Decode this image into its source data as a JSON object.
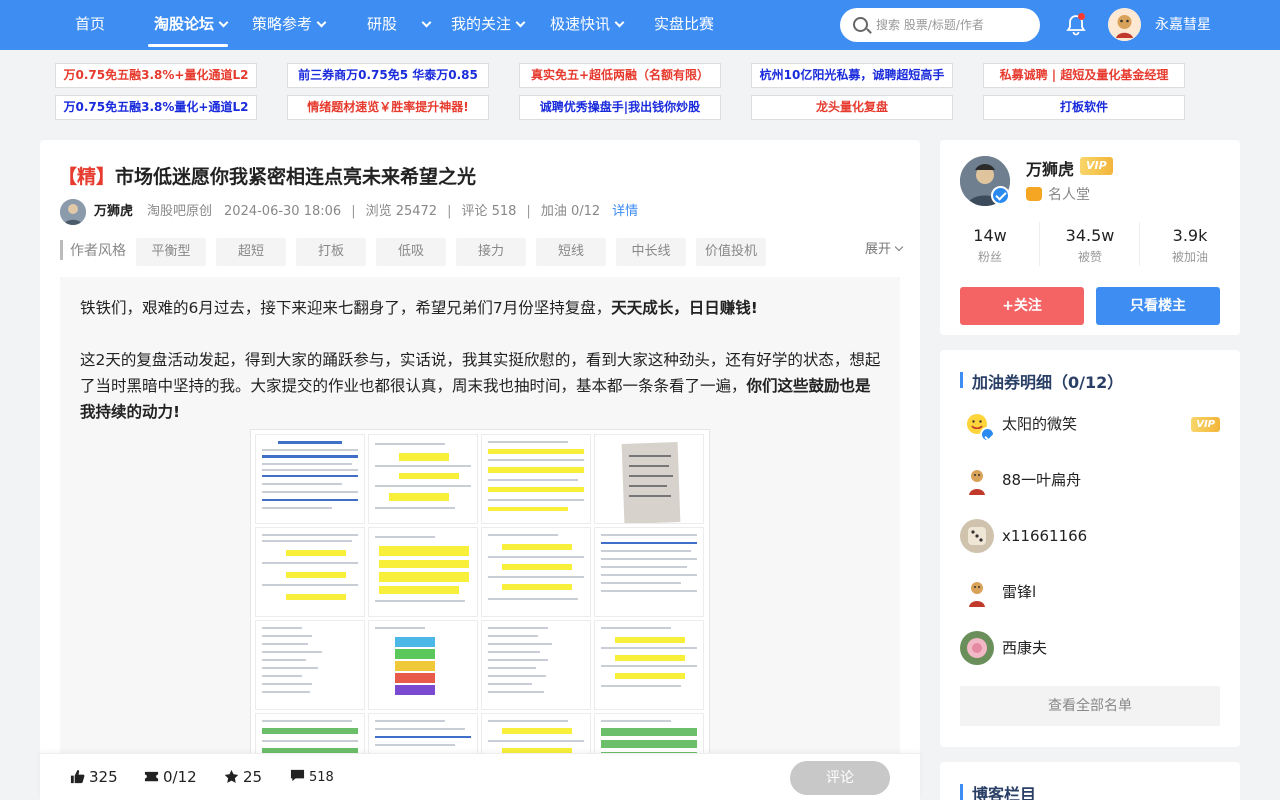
{
  "nav": {
    "items": [
      {
        "label": "首页",
        "dropdown": false,
        "active": false
      },
      {
        "label": "淘股论坛",
        "dropdown": true,
        "active": true
      },
      {
        "label": "策略参考",
        "dropdown": true,
        "active": false
      },
      {
        "label": "研股",
        "dropdown": true,
        "active": false
      },
      {
        "label": "我的关注",
        "dropdown": true,
        "active": false
      },
      {
        "label": "极速快讯",
        "dropdown": true,
        "active": false
      },
      {
        "label": "实盘比赛",
        "dropdown": false,
        "active": false
      }
    ],
    "search_placeholder": "搜索 股票/标题/作者",
    "username": "永嘉彗星",
    "accent": "#3d8df3"
  },
  "ads": [
    {
      "label": "万0.75免五融3.8%+量化通道L2",
      "color": "red"
    },
    {
      "label": "前三券商万0.75免5 华泰万0.85",
      "color": "blue"
    },
    {
      "label": "真实免五+超低两融（名额有限）",
      "color": "red"
    },
    {
      "label": "杭州10亿阳光私募，诚聘超短高手",
      "color": "blue"
    },
    {
      "label": "私募诚聘 | 超短及量化基金经理",
      "color": "red"
    },
    {
      "label": "万0.75免五融3.8%量化+通道L2",
      "color": "blue"
    },
    {
      "label": "情绪题材速览￥胜率提升神器!",
      "color": "red"
    },
    {
      "label": "诚聘优秀操盘手|我出钱你炒股",
      "color": "blue"
    },
    {
      "label": "龙头量化复盘",
      "color": "red"
    },
    {
      "label": "打板软件",
      "color": "blue"
    }
  ],
  "article": {
    "tag": "【精】",
    "title": "市场低迷愿你我紧密相连点亮未来希望之光",
    "author": "万狮虎",
    "source": "淘股吧原创",
    "datetime": "2024-06-30 18:06",
    "views": "浏览 25472",
    "comments": "评论 518",
    "fuel": "加油 0/12",
    "detail_link": "详情",
    "style_label": "作者风格",
    "styles": [
      "平衡型",
      "超短",
      "打板",
      "低吸",
      "接力",
      "短线",
      "中长线",
      "价值投机"
    ],
    "expand": "展开",
    "p1_text": "铁铁们，艰难的6月过去，接下来迎来七翻身了，希望兄弟们7月份坚持复盘，",
    "p1_bold": "天天成长，日日赚钱!",
    "p2_text": "这2天的复盘活动发起，得到大家的踊跃参与，实话说，我其实挺欣慰的，看到大家这种劲头，还有好学的状态，想起了当时黑暗中坚持的我。大家提交的作业也都很认真，周末我也抽时间，基本都一条条看了一遍，",
    "p2_bold": "你们这些鼓励也是我持续的动力!"
  },
  "actions": {
    "likes": "325",
    "fuel": "0/12",
    "favorites": "25",
    "comments": "518",
    "comment_button": "评论"
  },
  "profile": {
    "name": "万狮虎",
    "vip": "VIP",
    "fame": "名人堂",
    "stats": [
      {
        "num": "14w",
        "label": "粉丝"
      },
      {
        "num": "34.5w",
        "label": "被赞"
      },
      {
        "num": "3.9k",
        "label": "被加油"
      }
    ],
    "follow_button": "+关注",
    "only_host_button": "只看楼主"
  },
  "fuel_detail": {
    "title": "加油券明细（0/12）",
    "users": [
      {
        "name": "太阳的微笑",
        "vip": "VIP"
      },
      {
        "name": "88一叶扁舟",
        "vip": ""
      },
      {
        "name": "x11661166",
        "vip": ""
      },
      {
        "name": "雷锋l",
        "vip": ""
      },
      {
        "name": "西康夫",
        "vip": ""
      }
    ],
    "view_all": "查看全部名单"
  },
  "blog": {
    "title": "博客栏目"
  }
}
